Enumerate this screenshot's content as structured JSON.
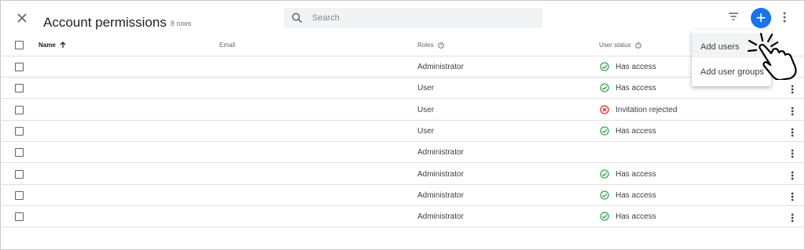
{
  "header": {
    "title": "Account permissions",
    "row_count": "8 rows",
    "close_icon": "close-icon",
    "search": {
      "placeholder": "Search",
      "icon": "search-icon"
    },
    "filter_icon": "filter-icon",
    "add_icon": "plus-icon",
    "more_icon": "more-vert-icon",
    "accent_color": "#1a73e8"
  },
  "table": {
    "columns": [
      {
        "label": "Name",
        "sort": "ascending"
      },
      {
        "label": "Email"
      },
      {
        "label": "Roles",
        "help": true
      },
      {
        "label": "User status",
        "help": true
      }
    ],
    "rows": [
      {
        "role": "Administrator",
        "status": "Has access",
        "status_type": "ok"
      },
      {
        "role": "User",
        "status": "Has access",
        "status_type": "ok"
      },
      {
        "role": "User",
        "status": "Invitation rejected",
        "status_type": "error"
      },
      {
        "role": "User",
        "status": "Has access",
        "status_type": "ok"
      },
      {
        "role": "Administrator",
        "status": "",
        "status_type": "none"
      },
      {
        "role": "Administrator",
        "status": "Has access",
        "status_type": "ok"
      },
      {
        "role": "Administrator",
        "status": "Has access",
        "status_type": "ok"
      },
      {
        "role": "Administrator",
        "status": "Has access",
        "status_type": "ok"
      }
    ],
    "status_colors": {
      "ok": "#34a853",
      "error": "#d93025"
    }
  },
  "add_menu": {
    "items": [
      {
        "label": "Add users",
        "hover": true
      },
      {
        "label": "Add user groups",
        "hover": false
      }
    ]
  }
}
